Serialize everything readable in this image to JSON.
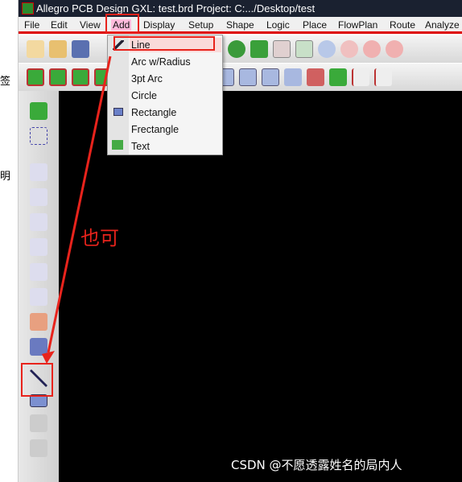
{
  "left_fragments": [
    "签",
    "明"
  ],
  "title": "Allegro PCB Design GXL: test.brd  Project: C:.../Desktop/test",
  "menubar": [
    "File",
    "Edit",
    "View",
    "Add",
    "Display",
    "Setup",
    "Shape",
    "Logic",
    "Place",
    "FlowPlan",
    "Route",
    "Analyze"
  ],
  "add_menu": {
    "items": [
      {
        "label": "Line",
        "icon": "line-icon"
      },
      {
        "label": "Arc w/Radius"
      },
      {
        "label": "3pt Arc"
      },
      {
        "label": "Circle"
      },
      {
        "label": "Rectangle",
        "icon": "rectangle-icon"
      },
      {
        "label": "Frectangle"
      },
      {
        "label": "Text",
        "icon": "text-icon"
      }
    ]
  },
  "annotation": "也可",
  "watermark": "CSDN @不愿透露姓名的局内人",
  "colors": {
    "highlight": "#e8231c",
    "canvas": "#000000"
  }
}
